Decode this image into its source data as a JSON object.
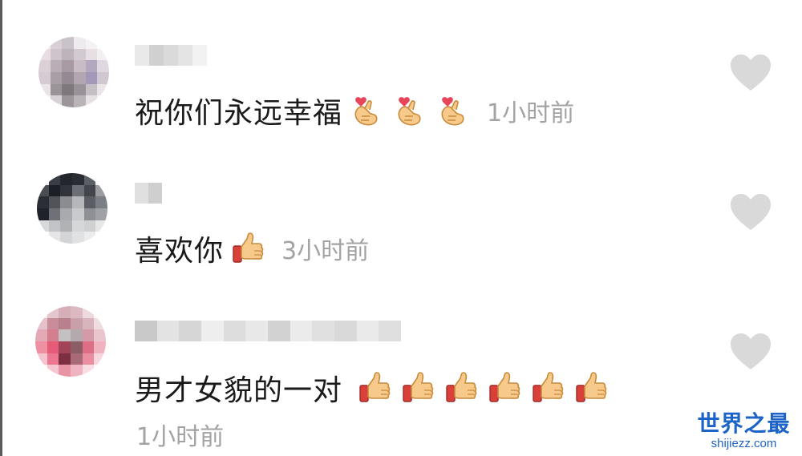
{
  "comments": [
    {
      "text": "祝你们永远幸福",
      "emoji": "finger-heart-emoji",
      "emoji_count": 3,
      "timestamp": "1小时前",
      "liked": false
    },
    {
      "text": "喜欢你",
      "emoji": "thumbs-up-emoji",
      "emoji_count": 1,
      "timestamp": "3小时前",
      "liked": false
    },
    {
      "text": "男才女貌的一对",
      "emoji": "thumbs-up-emoji",
      "emoji_count": 6,
      "timestamp": "1小时前",
      "liked": false
    }
  ],
  "icons": {
    "like": "heart-icon"
  },
  "colors": {
    "text": "#1a1a1a",
    "meta": "#a3a3a3",
    "heart": "#d9d9d9",
    "watermark": "#1e63c8"
  },
  "watermark": {
    "cn": "世界之最",
    "en": "shijiezz.com"
  }
}
